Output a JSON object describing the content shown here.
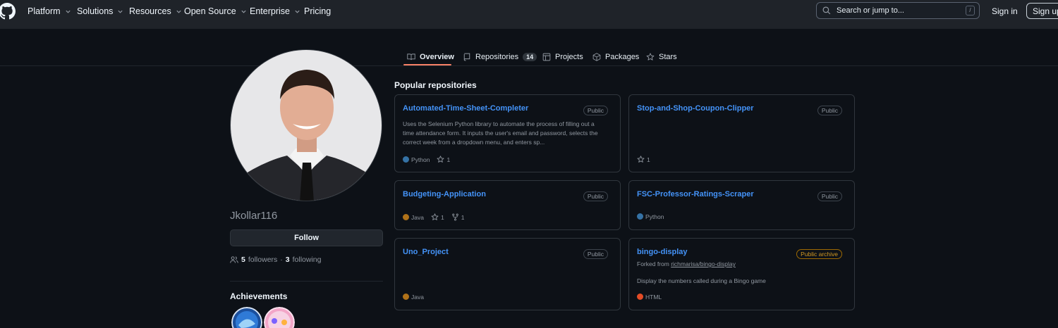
{
  "header": {
    "nav": [
      "Platform",
      "Solutions",
      "Resources",
      "Open Source",
      "Enterprise",
      "Pricing"
    ],
    "search_placeholder": "Search or jump to...",
    "search_shortcut": "/",
    "signin": "Sign in",
    "signup": "Sign up"
  },
  "tabs": [
    {
      "label": "Overview",
      "icon": "book-icon"
    },
    {
      "label": "Repositories",
      "icon": "repo-icon",
      "count": "14"
    },
    {
      "label": "Projects",
      "icon": "table-icon"
    },
    {
      "label": "Packages",
      "icon": "package-icon"
    },
    {
      "label": "Stars",
      "icon": "star-icon"
    }
  ],
  "profile": {
    "username": "Jkollar116",
    "follow_label": "Follow",
    "followers_count": "5",
    "followers_label": "followers",
    "separator": "·",
    "following_count": "3",
    "following_label": "following",
    "achievements_title": "Achievements"
  },
  "popular": {
    "title": "Popular repositories",
    "repos": [
      {
        "name": "Automated-Time-Sheet-Completer",
        "visibility": "Public",
        "description": "Uses the Selenium Python library to automate the process of filling out a time attendance form. It inputs the user's email and password, selects the correct week from a dropdown menu, and enters sp...",
        "language": "Python",
        "language_color": "#3572A5",
        "stars": "1"
      },
      {
        "name": "Stop-and-Shop-Coupon-Clipper",
        "visibility": "Public",
        "stars": "1"
      },
      {
        "name": "Budgeting-Application",
        "visibility": "Public",
        "language": "Java",
        "language_color": "#b07219",
        "stars": "1",
        "forks": "1"
      },
      {
        "name": "FSC-Professor-Ratings-Scraper",
        "visibility": "Public",
        "language": "Python",
        "language_color": "#3572A5"
      },
      {
        "name": "Uno_Project",
        "visibility": "Public",
        "language": "Java",
        "language_color": "#b07219"
      },
      {
        "name": "bingo-display",
        "visibility": "Public archive",
        "forked_prefix": "Forked from",
        "forked_from": "richmarisa/bingo-display",
        "description": "Display the numbers called during a Bingo game",
        "language": "HTML",
        "language_color": "#e34c26"
      }
    ]
  },
  "colors": {
    "accent_link": "#4493f8",
    "tab_underline": "#f78166",
    "archive": "#d29922"
  }
}
